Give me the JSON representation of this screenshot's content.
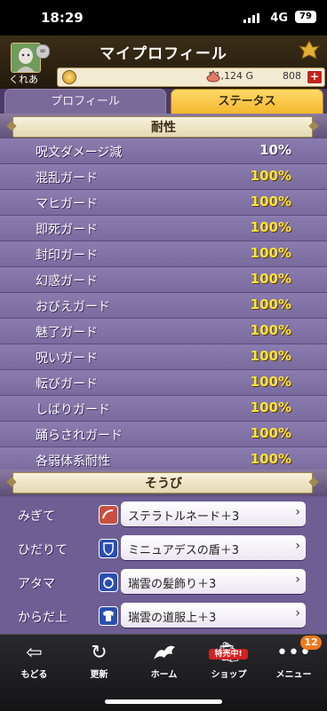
{
  "status_bar": {
    "time": "18:29",
    "network": "4G",
    "battery": "79"
  },
  "header": {
    "title": "マイプロフィール",
    "player_name": "くれあ",
    "gold": "51,124 G",
    "gems": "808",
    "plus": "+"
  },
  "tabs": [
    {
      "label": "プロフィール",
      "active": false
    },
    {
      "label": "ステータス",
      "active": true
    }
  ],
  "resistance": {
    "title": "耐性",
    "rows": [
      {
        "name": "呪文ダメージ減",
        "value": "10%"
      },
      {
        "name": "混乱ガード",
        "value": "100%"
      },
      {
        "name": "マヒガード",
        "value": "100%"
      },
      {
        "name": "即死ガード",
        "value": "100%"
      },
      {
        "name": "封印ガード",
        "value": "100%"
      },
      {
        "name": "幻惑ガード",
        "value": "100%"
      },
      {
        "name": "おびえガード",
        "value": "100%"
      },
      {
        "name": "魅了ガード",
        "value": "100%"
      },
      {
        "name": "呪いガード",
        "value": "100%"
      },
      {
        "name": "転びガード",
        "value": "100%"
      },
      {
        "name": "しばりガード",
        "value": "100%"
      },
      {
        "name": "踊らされガード",
        "value": "100%"
      },
      {
        "name": "各弱体系耐性",
        "value": "100%"
      }
    ]
  },
  "equipment": {
    "title": "そうび",
    "rows": [
      {
        "slot": "みぎて",
        "item": "ステラトルネード＋3",
        "icon": "whip-icon",
        "icon_color": "#c85040"
      },
      {
        "slot": "ひだりて",
        "item": "ミニュアデスの盾＋3",
        "icon": "shield-icon",
        "icon_color": "#2a4fb0"
      },
      {
        "slot": "アタマ",
        "item": "瑞雲の髪飾り＋3",
        "icon": "head-icon",
        "icon_color": "#2a4fb0"
      },
      {
        "slot": "からだ上",
        "item": "瑞雲の道服上＋3",
        "icon": "body-armor-icon",
        "icon_color": "#2a4fb0"
      }
    ]
  },
  "nav": {
    "items": [
      {
        "label": "もどる",
        "icon": "back-arrow-icon"
      },
      {
        "label": "更新",
        "icon": "refresh-icon"
      },
      {
        "label": "ホーム",
        "icon": "home-dragon-icon"
      },
      {
        "label": "ショップ",
        "icon": "shop-icon"
      },
      {
        "label": "メニュー",
        "icon": "menu-dots-icon"
      }
    ],
    "sale_badge": "特売中!",
    "menu_count": "12"
  },
  "colors": {
    "accent_gold": "#ffe23a",
    "tab_active": "#f2b72a",
    "panel_purple": "#7a6b9e"
  }
}
